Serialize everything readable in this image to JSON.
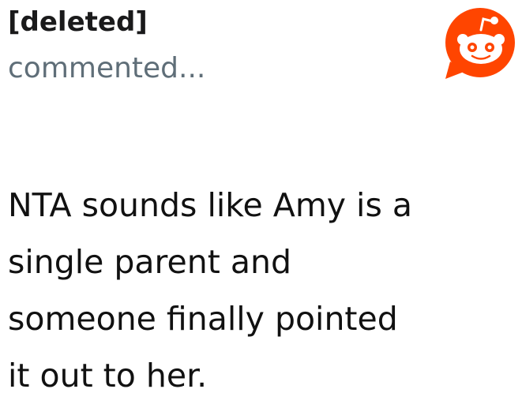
{
  "comment": {
    "author": "[deleted]",
    "action": "commented...",
    "lines": [
      "NTA sounds like Amy is a",
      "single parent and",
      "someone finally pointed",
      "it out to her."
    ]
  },
  "logo": {
    "icon": "reddit-snoo-icon",
    "background_color": "#ff4500",
    "face_color": "#ffffff"
  }
}
